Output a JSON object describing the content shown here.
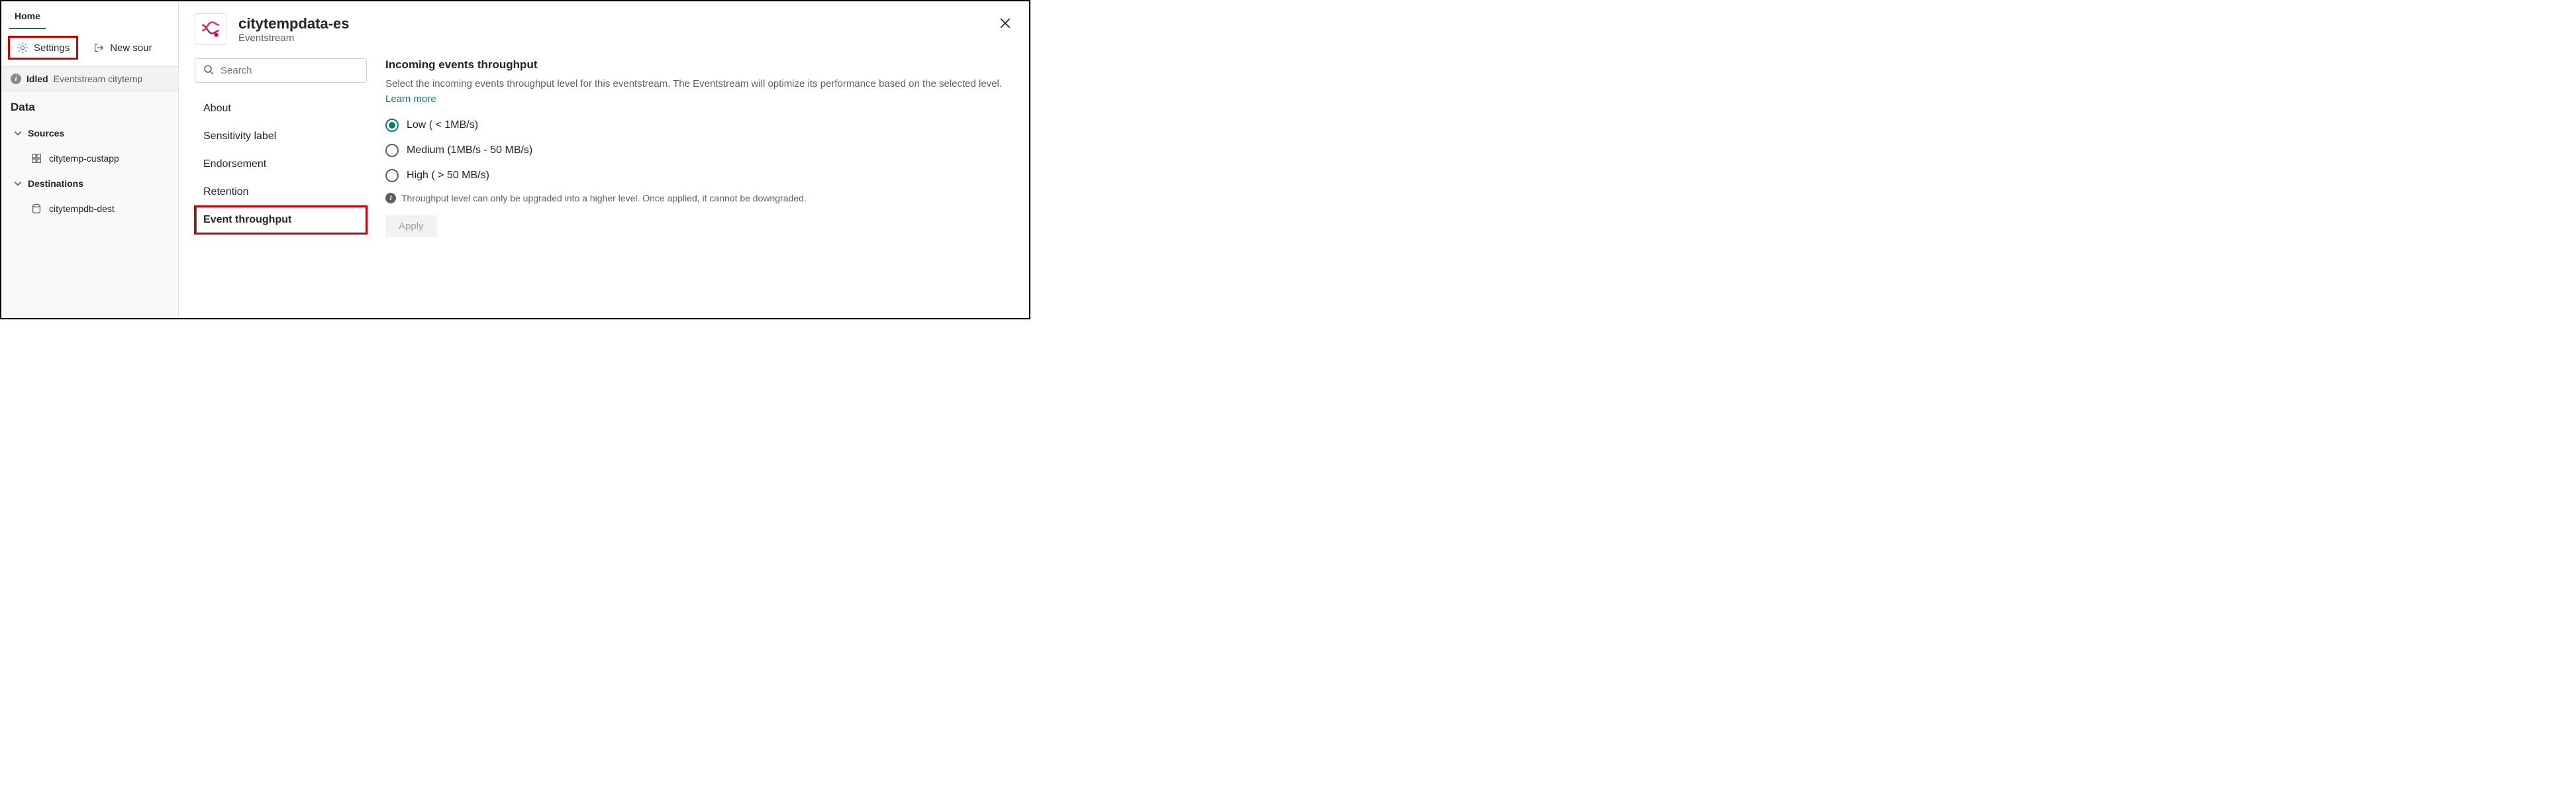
{
  "left": {
    "tab_home": "Home",
    "toolbar": {
      "settings_label": "Settings",
      "new_source_label": "New sour"
    },
    "status": {
      "idled": "Idled",
      "text": "Eventstream citytemp"
    },
    "data_heading": "Data",
    "sources_label": "Sources",
    "sources": [
      {
        "label": "citytemp-custapp"
      }
    ],
    "destinations_label": "Destinations",
    "destinations": [
      {
        "label": "citytempdb-dest"
      }
    ]
  },
  "panel": {
    "title": "citytempdata-es",
    "subtitle": "Eventstream",
    "search_placeholder": "Search",
    "nav": [
      "About",
      "Sensitivity label",
      "Endorsement",
      "Retention",
      "Event throughput"
    ],
    "section": {
      "title": "Incoming events throughput",
      "desc": "Select the incoming events throughput level for this eventstream. The Eventstream will optimize its performance based on the selected level.",
      "learn_more": "Learn more",
      "options": [
        "Low ( < 1MB/s)",
        "Medium (1MB/s - 50 MB/s)",
        "High ( > 50 MB/s)"
      ],
      "selected_index": 0,
      "note": "Throughput level can only be upgraded into a higher level. Once applied, it cannot be downgraded.",
      "apply": "Apply"
    }
  }
}
